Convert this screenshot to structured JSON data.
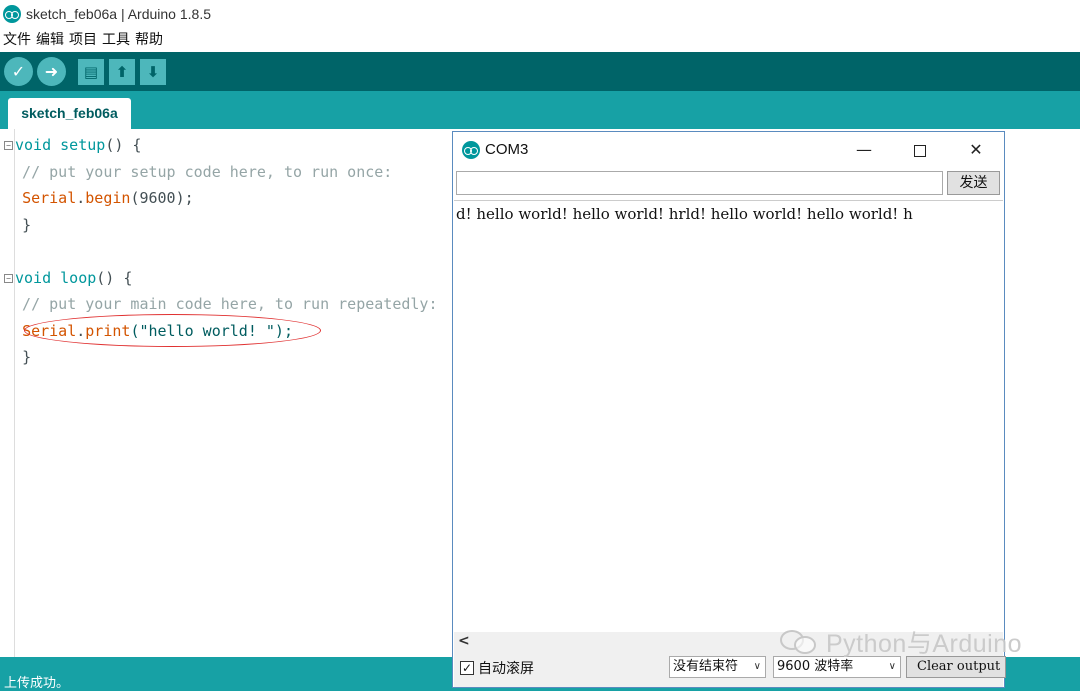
{
  "app": {
    "title": "sketch_feb06a | Arduino 1.8.5",
    "menu": [
      "文件",
      "编辑",
      "项目",
      "工具",
      "帮助"
    ],
    "toolbar": {
      "verify_icon": "check-icon",
      "upload_icon": "arrow-right-icon",
      "new_icon": "document-icon",
      "open_icon": "arrow-up-icon",
      "save_icon": "arrow-down-icon"
    },
    "tab": "sketch_feb06a",
    "status": "上传成功。"
  },
  "code": {
    "l1_kw": "void",
    "l1_fn": " setup",
    "l1_rest": "() {",
    "l2": "  // put your setup code here, to run once:",
    "l3_cls": "Serial",
    "l3_dot": ".",
    "l3_fn": "begin",
    "l3_rest": "(9600);",
    "l4": "}",
    "l6_kw": "void",
    "l6_fn": " loop",
    "l6_rest": "() {",
    "l7": "  // put your main code here, to run repeatedly:",
    "l8_cls": "Serial",
    "l8_dot": ".",
    "l8_fn": "print",
    "l8_str": "(\"hello world! \");",
    "l9": "}"
  },
  "monitor": {
    "title": "COM3",
    "send_label": "发送",
    "input_value": "",
    "output": "d! hello world! hello world! hrld! hello world! hello world! h",
    "autoscroll_label": "自动滚屏",
    "autoscroll_checked": "✓",
    "line_ending": "没有结束符",
    "baud": "9600 波特率",
    "clear_label": "Clear output"
  },
  "watermark": "Python与Arduino"
}
